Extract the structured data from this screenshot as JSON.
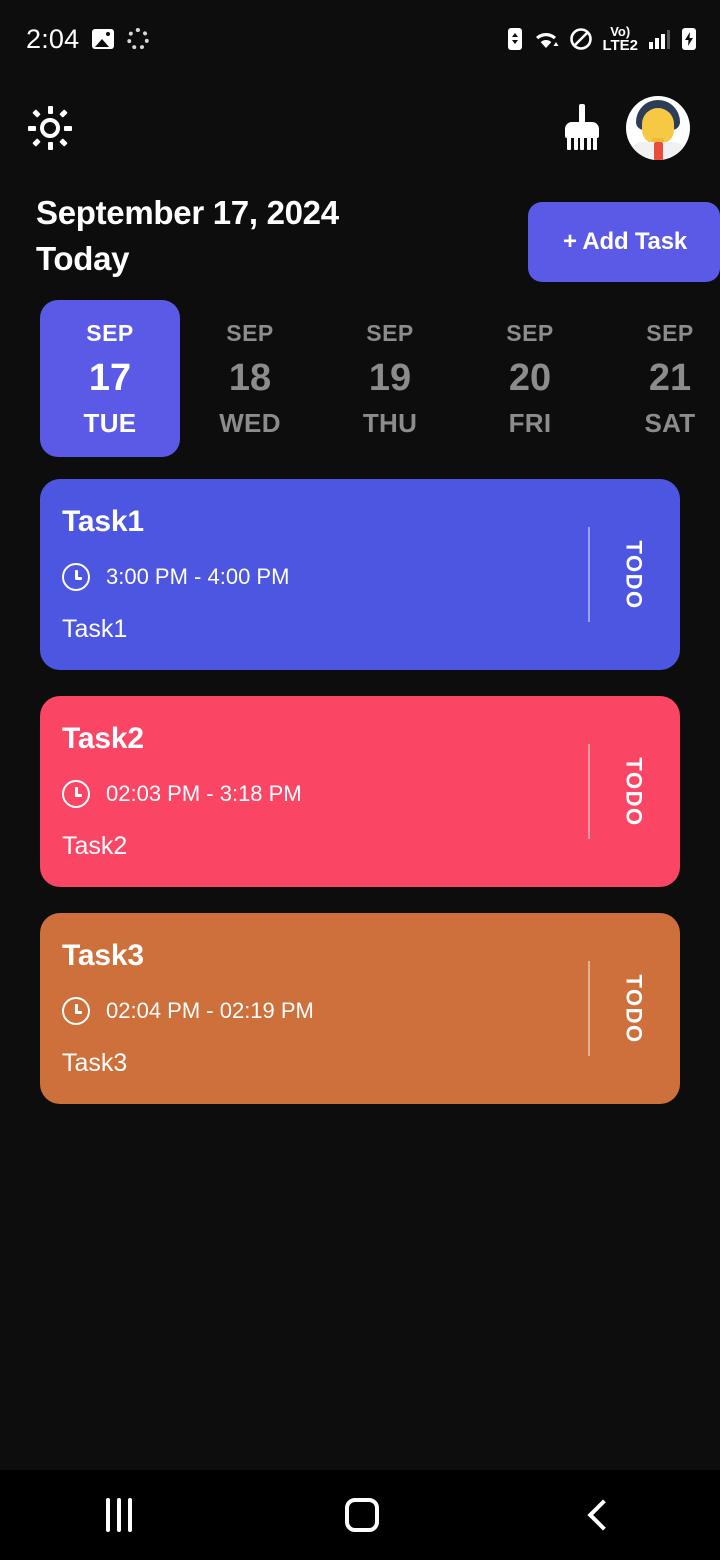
{
  "status_bar": {
    "time": "2:04",
    "left_icons": [
      "image-icon",
      "dotted-circle-icon"
    ],
    "right_icons": [
      "battery-saver-icon",
      "wifi-icon",
      "do-not-disturb-icon",
      "volte-icon",
      "signal-icon",
      "battery-charging-icon"
    ],
    "network_label": "Vo)",
    "network_sub": "LTE2"
  },
  "app_bar": {
    "brightness_icon": "sun-icon",
    "clean_icon": "broom-icon",
    "avatar_icon": "user-avatar"
  },
  "header": {
    "date_line": "September 17, 2024",
    "today_line": "Today",
    "add_task_label": "+ Add Task"
  },
  "date_strip": {
    "dates": [
      {
        "month": "SEP",
        "day": "17",
        "weekday": "TUE",
        "selected": true
      },
      {
        "month": "SEP",
        "day": "18",
        "weekday": "WED",
        "selected": false
      },
      {
        "month": "SEP",
        "day": "19",
        "weekday": "THU",
        "selected": false
      },
      {
        "month": "SEP",
        "day": "20",
        "weekday": "FRI",
        "selected": false
      },
      {
        "month": "SEP",
        "day": "21",
        "weekday": "SAT",
        "selected": false
      }
    ]
  },
  "tasks": [
    {
      "title": "Task1",
      "time": "3:00 PM - 4:00 PM",
      "description": "Task1",
      "status": "TODO",
      "color": "#4c56e0"
    },
    {
      "title": "Task2",
      "time": "02:03 PM - 3:18 PM",
      "description": "Task2",
      "status": "TODO",
      "color": "#fb4565"
    },
    {
      "title": "Task3",
      "time": "02:04 PM - 02:19 PM",
      "description": "Task3",
      "status": "TODO",
      "color": "#cd703b"
    }
  ],
  "nav_bar": {
    "recents_label": "recents-button",
    "home_label": "home-button",
    "back_label": "back-button"
  },
  "colors": {
    "accent": "#5a5ae6",
    "background": "#0d0d0d",
    "muted_text": "#8c8c8c"
  }
}
